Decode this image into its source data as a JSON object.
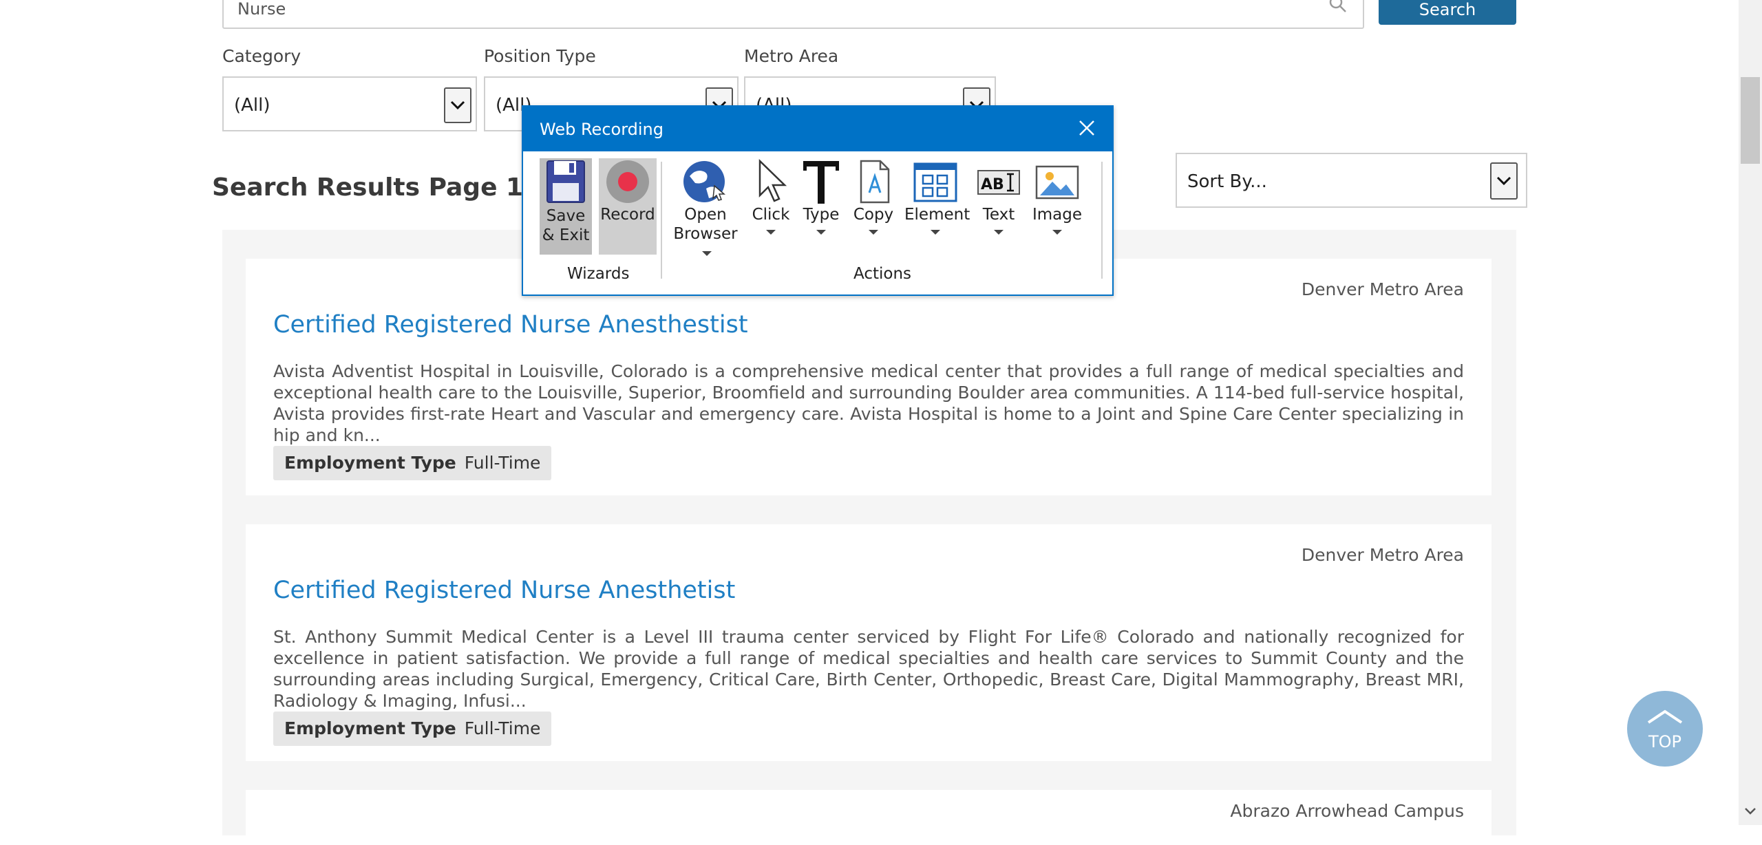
{
  "search": {
    "value": "Nurse",
    "button_label": "Search"
  },
  "filters": {
    "category": {
      "label": "Category",
      "value": "(All)"
    },
    "position_type": {
      "label": "Position Type",
      "value": "(All)"
    },
    "metro_area": {
      "label": "Metro Area",
      "value": "(All)"
    }
  },
  "results": {
    "title": "Search Results Page 1 of 3",
    "sort_value": "Sort By...",
    "items": [
      {
        "location": "Denver Metro Area",
        "title": "Certified Registered Nurse Anesthestist",
        "description": "Avista Adventist Hospital in Louisville, Colorado is a comprehensive medical center that provides a full range of medical specialties and exceptional health care to the Louisville, Superior, Broomfield and surrounding Boulder area communities. A 114-bed full-service hospital, Avista provides first-rate Heart and Vascular and emergency care. Avista Hospital is home to a Joint and Spine Care Center specializing in hip and kn...",
        "badge_label": "Employment Type",
        "badge_value": "Full-Time"
      },
      {
        "location": "Denver Metro Area",
        "title": "Certified Registered Nurse Anesthetist",
        "description": "St. Anthony Summit Medical Center is a Level III trauma center serviced by Flight For Life® Colorado and nationally recognized for excellence in patient satisfaction. We provide a full range of medical specialties and health care services to Summit County and the surrounding areas including Surgical, Emergency, Critical Care, Birth Center, Orthopedic, Breast Care, Digital Mammography, Breast MRI, Radiology & Imaging, Infusi...",
        "badge_label": "Employment Type",
        "badge_value": "Full-Time"
      },
      {
        "location": "Abrazo Arrowhead Campus"
      }
    ]
  },
  "top_button": {
    "label": "TOP"
  },
  "dialog": {
    "title": "Web Recording",
    "wizards_label": "Wizards",
    "actions_label": "Actions",
    "tools": {
      "save_line1": "Save",
      "save_line2": "& Exit",
      "record": "Record",
      "open_line1": "Open",
      "open_line2": "Browser",
      "click": "Click",
      "type": "Type",
      "copy": "Copy",
      "element": "Element",
      "text": "Text",
      "image": "Image",
      "text_icon_glyphs": "AB"
    }
  },
  "colors": {
    "link": "#1f7fc4",
    "search_button": "#1e6a9a",
    "dialog_header": "#0072c6",
    "top_button": "#8fb8d8"
  }
}
